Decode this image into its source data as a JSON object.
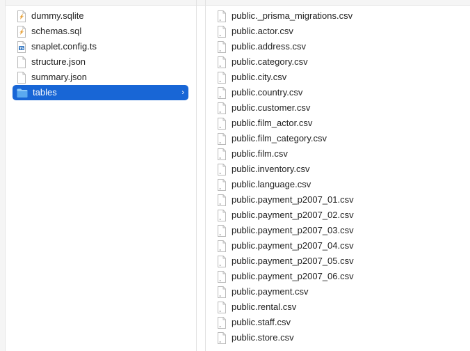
{
  "sidebar_column": {
    "items": [
      {
        "label": "dummy.sqlite",
        "icon": "sqlite-file-icon"
      },
      {
        "label": "schemas.sql",
        "icon": "sql-file-icon"
      },
      {
        "label": "snaplet.config.ts",
        "icon": "typescript-file-icon"
      },
      {
        "label": "structure.json",
        "icon": "document-icon"
      },
      {
        "label": "summary.json",
        "icon": "document-icon"
      },
      {
        "label": "tables",
        "icon": "folder-icon",
        "selected": true,
        "chevron": "›"
      }
    ]
  },
  "files_column": {
    "items": [
      {
        "label": "public._prisma_migrations.csv"
      },
      {
        "label": "public.actor.csv"
      },
      {
        "label": "public.address.csv"
      },
      {
        "label": "public.category.csv"
      },
      {
        "label": "public.city.csv"
      },
      {
        "label": "public.country.csv"
      },
      {
        "label": "public.customer.csv"
      },
      {
        "label": "public.film_actor.csv"
      },
      {
        "label": "public.film_category.csv"
      },
      {
        "label": "public.film.csv"
      },
      {
        "label": "public.inventory.csv"
      },
      {
        "label": "public.language.csv"
      },
      {
        "label": "public.payment_p2007_01.csv"
      },
      {
        "label": "public.payment_p2007_02.csv"
      },
      {
        "label": "public.payment_p2007_03.csv"
      },
      {
        "label": "public.payment_p2007_04.csv"
      },
      {
        "label": "public.payment_p2007_05.csv"
      },
      {
        "label": "public.payment_p2007_06.csv"
      },
      {
        "label": "public.payment.csv"
      },
      {
        "label": "public.rental.csv"
      },
      {
        "label": "public.staff.csv"
      },
      {
        "label": "public.store.csv"
      }
    ]
  },
  "colors": {
    "selection": "#1866d6",
    "folder": "#5aa9f0",
    "ts_badge": "#2f74c0",
    "sqlite_accent": "#e8a33d"
  }
}
